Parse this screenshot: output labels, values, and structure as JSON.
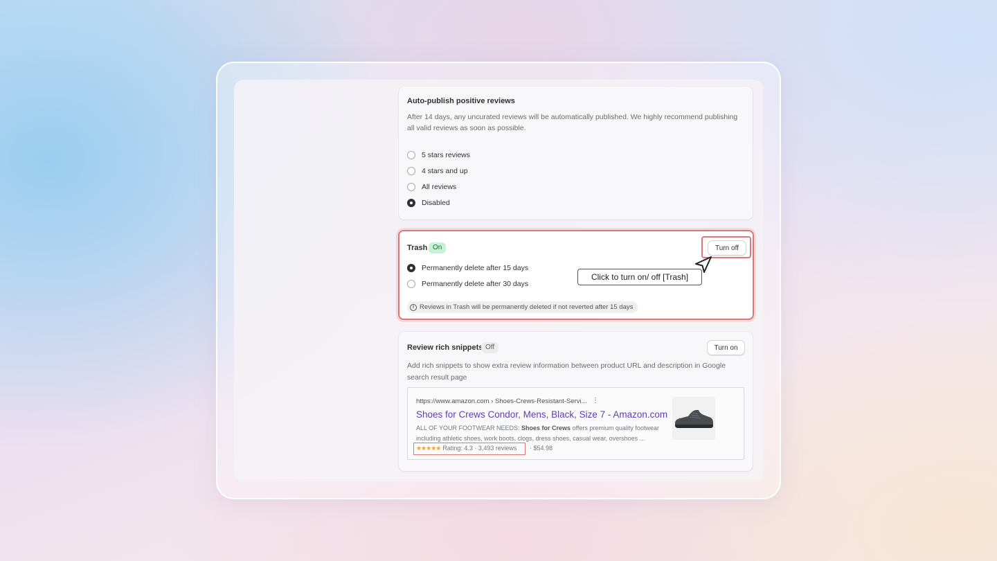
{
  "auto_publish": {
    "title": "Auto-publish positive reviews",
    "desc_line1": "After 14 days, any uncurated reviews will be automatically published. We highly recommend publishing",
    "desc_line2": "all valid reviews as soon as possible.",
    "options": [
      {
        "label": "5 stars reviews",
        "checked": false
      },
      {
        "label": "4 stars and up",
        "checked": false
      },
      {
        "label": "All reviews",
        "checked": false
      },
      {
        "label": "Disabled",
        "checked": true
      }
    ]
  },
  "trash": {
    "title": "Trash",
    "badge": "On",
    "button_label": "Turn off",
    "options": [
      {
        "label": "Permanently delete after 15 days",
        "checked": true
      },
      {
        "label": "Permanently delete after 30 days",
        "checked": false
      }
    ],
    "info": "Reviews in Trash will be permanently deleted if not reverted after 15 days",
    "tooltip": "Click to turn on/ off [Trash]"
  },
  "rich_snippets": {
    "title": "Review rich snippets",
    "badge": "Off",
    "button_label": "Turn on",
    "desc_line1": "Add rich snippets to show extra review information between product URL and description in Google",
    "desc_line2": "search result page",
    "preview": {
      "url": "https://www.amazon.com › Shoes-Crews-Resistant-Servi...",
      "dots": "⋮",
      "title": "Shoes for Crews Condor, Mens, Black, Size 7 - Amazon.com",
      "snippet_pre": "ALL OF YOUR FOOTWEAR NEEDS: ",
      "snippet_bold": "Shoes for Crews",
      "snippet_post": " offers premium quality footwear including athletic shoes, work boots, clogs, dress shoes, casual wear, overshoes ...",
      "stars": "★★★★★",
      "rating": "Rating: 4.3 · 3,493 reviews",
      "price": "· $54.98"
    }
  },
  "colors": {
    "highlight": "#e07575",
    "badge_on_bg": "#c8f2d4",
    "serp_title": "#5a3db8",
    "star": "#e9a53b"
  }
}
